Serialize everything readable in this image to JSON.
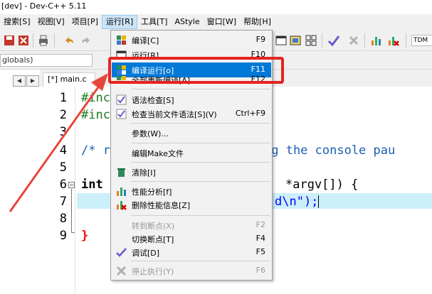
{
  "window": {
    "title": "[dev] - Dev-C++ 5.11"
  },
  "menubar": {
    "items": [
      "搜索[S]",
      "视图[V]",
      "项目[P]",
      "运行[R]",
      "工具[T]",
      "AStyle",
      "窗口[W]",
      "帮助[H]"
    ],
    "active_index": 3
  },
  "toolbar": {
    "right_label": "TDM"
  },
  "scope": {
    "value": "globals)"
  },
  "editor": {
    "tab_label": "[*] main.c",
    "line_numbers": [
      "1",
      "2",
      "3",
      "4",
      "5",
      "6",
      "7",
      "8",
      "9"
    ],
    "code_lines": [
      "#inc",
      "#inc",
      "",
      "/* r",
      "",
      "int",
      "",
      "",
      "}"
    ],
    "line4_tail": "ng the console pau",
    "line6_tail": "*argv[]) {",
    "line7_tail": "d\\n\");",
    "highlight_line": 7
  },
  "run_menu": {
    "items": [
      {
        "label": "编译[C]",
        "shortcut": "F9",
        "icon": "compile-icon",
        "enabled": true
      },
      {
        "label": "运行[R]",
        "shortcut": "F10",
        "icon": "run-icon",
        "enabled": true
      },
      {
        "label": "编译运行[o]",
        "shortcut": "F11",
        "icon": "compile-run-icon",
        "enabled": true,
        "selected": true
      },
      {
        "label": "全部重新编译[A]",
        "shortcut": "F12",
        "icon": "rebuild-icon",
        "enabled": true
      },
      {
        "label": "语法检查[S]",
        "shortcut": "",
        "icon": "syntax-check-icon",
        "enabled": true
      },
      {
        "label": "检查当前文件语法[S](V)",
        "shortcut": "Ctrl+F9",
        "icon": "syntax-check-file-icon",
        "enabled": true
      },
      {
        "label": "参数(W)...",
        "shortcut": "",
        "icon": "",
        "enabled": true
      },
      {
        "label": "编辑Make文件",
        "shortcut": "",
        "icon": "",
        "enabled": true
      },
      {
        "label": "清除[I]",
        "shortcut": "",
        "icon": "clean-icon",
        "enabled": true
      },
      {
        "label": "性能分析[f]",
        "shortcut": "",
        "icon": "profile-icon",
        "enabled": true
      },
      {
        "label": "删除性能信息[Z]",
        "shortcut": "",
        "icon": "delete-profile-icon",
        "enabled": true
      },
      {
        "label": "转到断点(X)",
        "shortcut": "F2",
        "icon": "",
        "enabled": false
      },
      {
        "label": "切换断点[T]",
        "shortcut": "F4",
        "icon": "",
        "enabled": true
      },
      {
        "label": "调试[D]",
        "shortcut": "F5",
        "icon": "debug-check-icon",
        "enabled": true
      },
      {
        "label": "停止执行(Y)",
        "shortcut": "F6",
        "icon": "stop-icon",
        "enabled": false
      }
    ]
  },
  "colors": {
    "highlight_box": "#e52420",
    "arrow": "#e8463a",
    "menu_selection": "#0078d7",
    "current_line": "#ccf0fa",
    "code_comment": "#1a5fb4",
    "code_keyword": "#000000",
    "code_directive": "#1d7a1d",
    "code_string": "#0000ff",
    "brace": "#ff0000"
  }
}
